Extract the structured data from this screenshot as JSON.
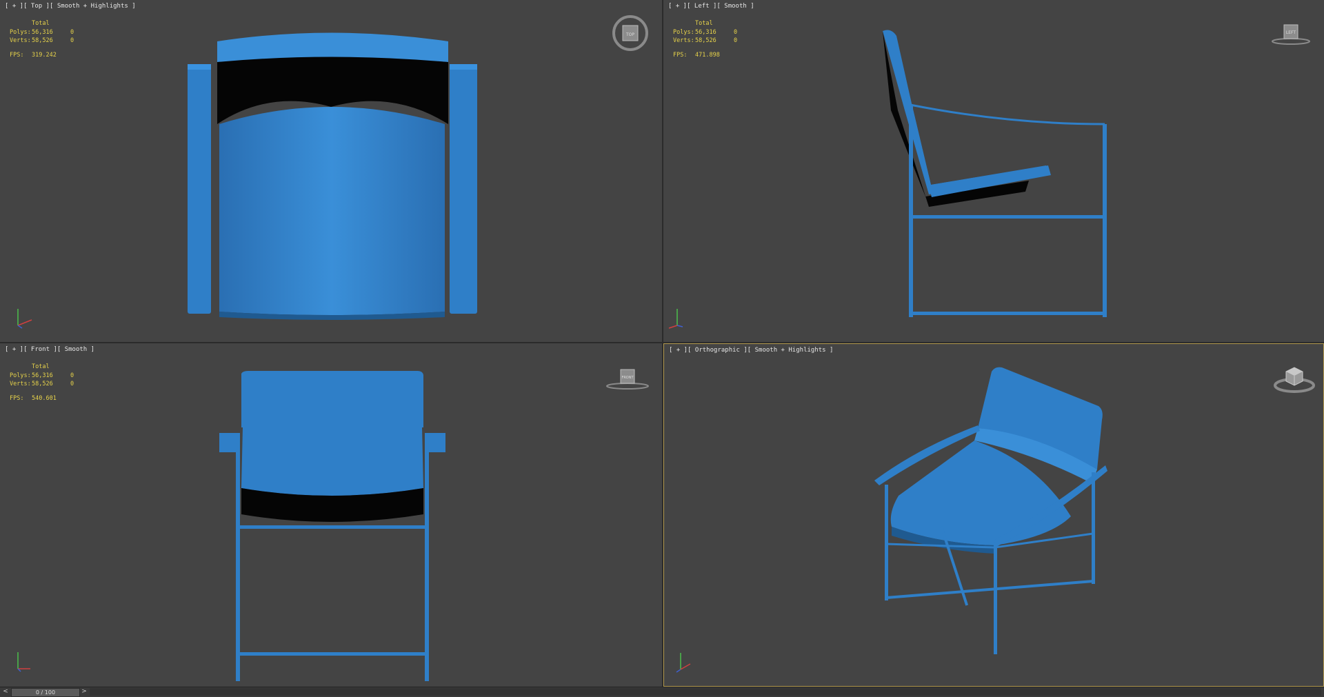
{
  "viewports": {
    "top": {
      "label": "[ + ][ Top ][ Smooth + Highlights ]",
      "stats": {
        "total_label": "Total",
        "polys_label": "Polys:",
        "polys_value": "56,316",
        "polys_sel": "0",
        "verts_label": "Verts:",
        "verts_value": "58,526",
        "verts_sel": "0",
        "fps_label": "FPS:",
        "fps_value": "319.242"
      },
      "gizmo_text": "TOP"
    },
    "left": {
      "label": "[ + ][ Left ][ Smooth ]",
      "stats": {
        "total_label": "Total",
        "polys_label": "Polys:",
        "polys_value": "56,316",
        "polys_sel": "0",
        "verts_label": "Verts:",
        "verts_value": "58,526",
        "verts_sel": "0",
        "fps_label": "FPS:",
        "fps_value": "471.898"
      },
      "gizmo_text": "LEFT"
    },
    "front": {
      "label": "[ + ][ Front ][ Smooth ]",
      "stats": {
        "total_label": "Total",
        "polys_label": "Polys:",
        "polys_value": "56,316",
        "polys_sel": "0",
        "verts_label": "Verts:",
        "verts_value": "58,526",
        "verts_sel": "0",
        "fps_label": "FPS:",
        "fps_value": "540.601"
      },
      "gizmo_text": "FRONT"
    },
    "persp": {
      "label": "[ + ][ Orthographic ][ Smooth + Highlights ]"
    }
  },
  "timeline": {
    "prev": "<",
    "next": ">",
    "frame": "0 / 100"
  },
  "colors": {
    "model": "#2f7fc8",
    "background": "#444444",
    "stats": "#e6d24a",
    "active_border": "#b39a4e"
  }
}
